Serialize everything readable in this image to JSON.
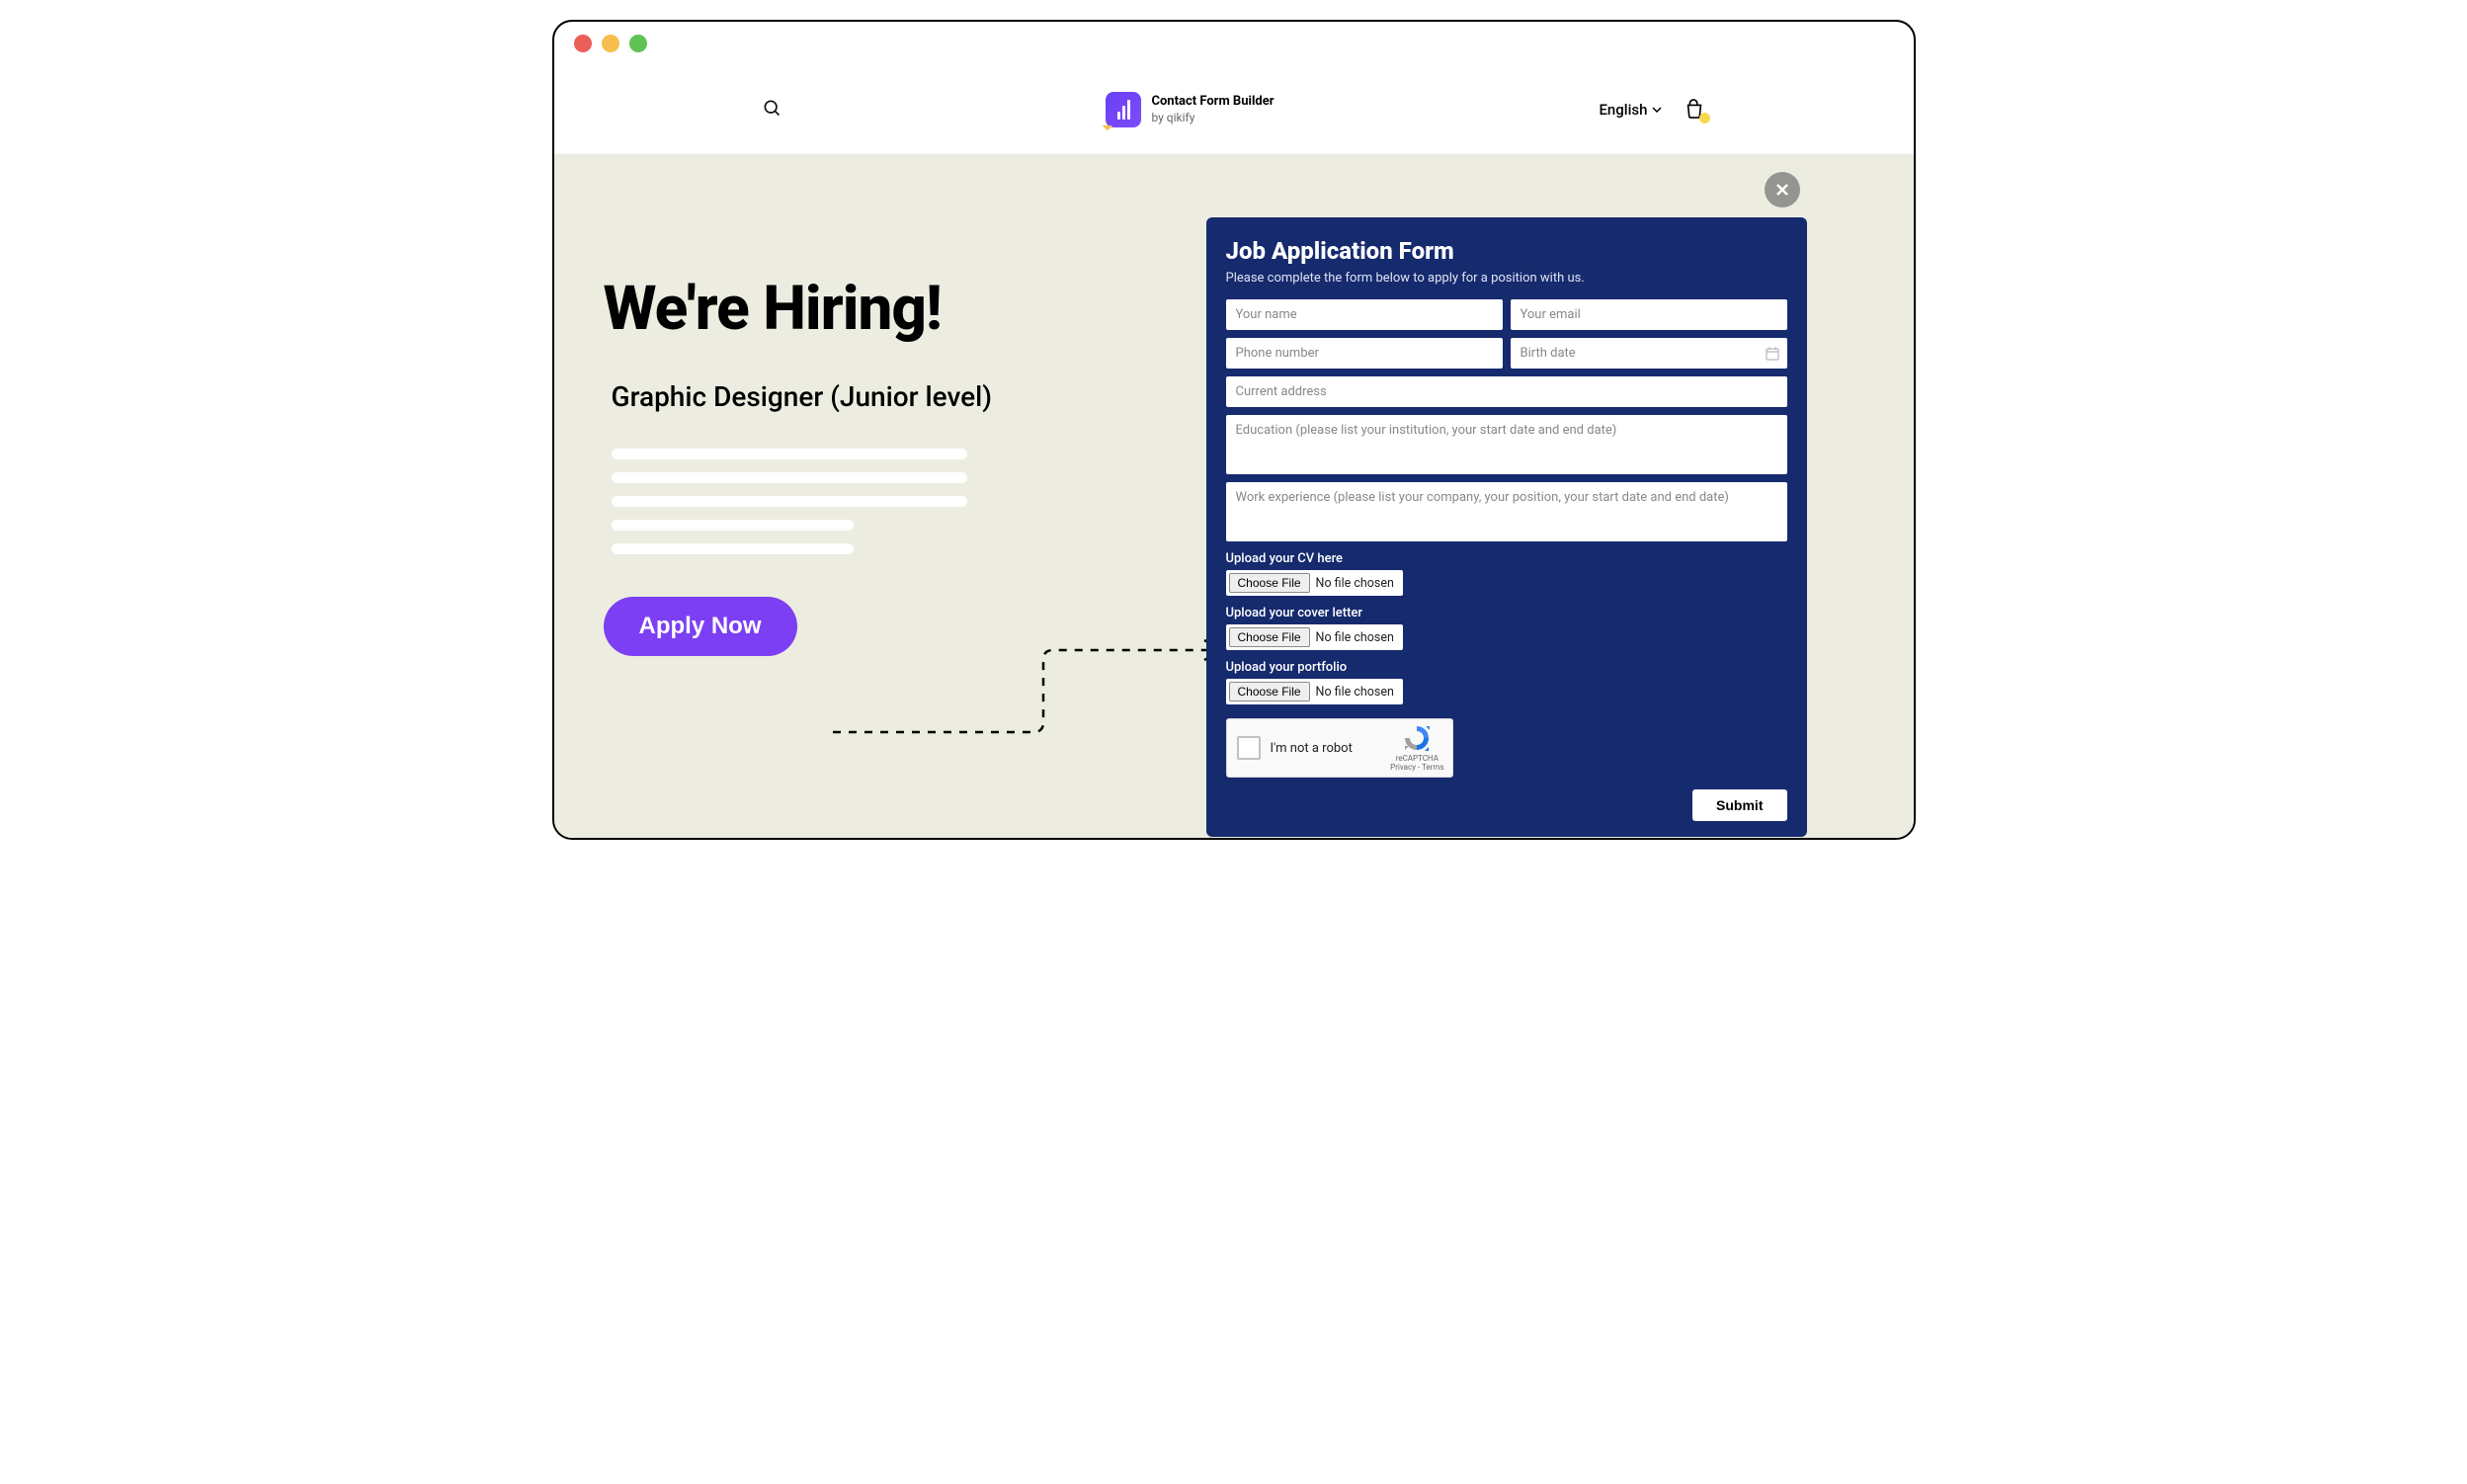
{
  "brand": {
    "title": "Contact Form Builder",
    "subtitle": "by qikify"
  },
  "toolbar": {
    "language": "English"
  },
  "hiring": {
    "headline": "We're Hiring!",
    "position": "Graphic Designer (Junior level)",
    "apply_label": "Apply Now"
  },
  "form": {
    "title": "Job Application Form",
    "description": "Please complete the form below to apply for a position with us.",
    "fields": {
      "name_placeholder": "Your name",
      "email_placeholder": "Your email",
      "phone_placeholder": "Phone number",
      "birthdate_placeholder": "Birth date",
      "address_placeholder": "Current address",
      "education_placeholder": "Education (please list your institution, your start date and end date)",
      "work_placeholder": "Work experience (please list your company, your position, your start date and end date)"
    },
    "uploads": {
      "cv_label": "Upload your CV here",
      "cover_label": "Upload your cover letter",
      "portfolio_label": "Upload your portfolio",
      "choose_file": "Choose File",
      "no_file": "No file chosen"
    },
    "recaptcha": {
      "label": "I'm not a robot",
      "brand": "reCAPTCHA",
      "legal": "Privacy - Terms"
    },
    "submit_label": "Submit"
  }
}
